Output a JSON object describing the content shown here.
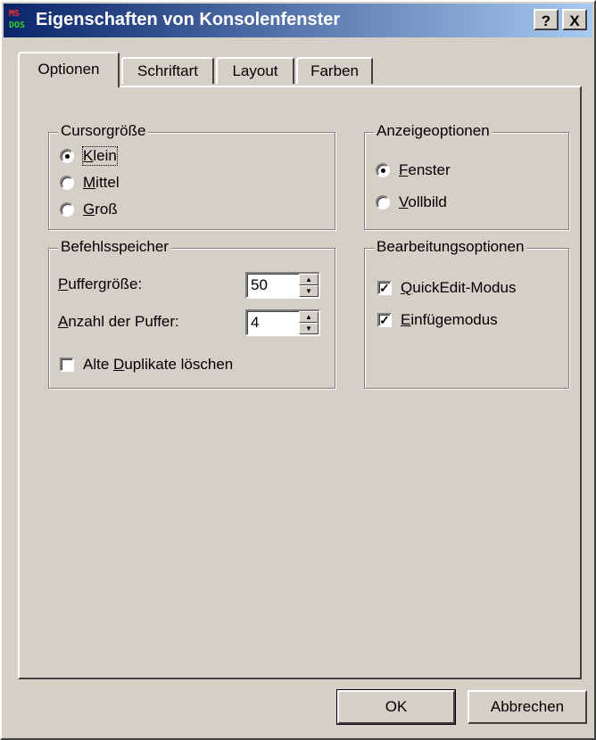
{
  "window": {
    "title": "Eigenschaften von Konsolenfenster",
    "icon_label": [
      "MS",
      "DOS"
    ],
    "help_button": "?",
    "close_button": "X"
  },
  "tabs": [
    {
      "label": "Optionen",
      "active": true
    },
    {
      "label": "Schriftart",
      "active": false
    },
    {
      "label": "Layout",
      "active": false
    },
    {
      "label": "Farben",
      "active": false
    }
  ],
  "cursor_size": {
    "legend": "Cursorgröße",
    "options": [
      {
        "pre": "",
        "mnemonic": "K",
        "post": "lein",
        "selected": true
      },
      {
        "pre": "",
        "mnemonic": "M",
        "post": "ittel",
        "selected": false
      },
      {
        "pre": "",
        "mnemonic": "G",
        "post": "roß",
        "selected": false
      }
    ]
  },
  "display_options": {
    "legend": "Anzeigeoptionen",
    "options": [
      {
        "pre": "",
        "mnemonic": "F",
        "post": "enster",
        "selected": true
      },
      {
        "pre": "",
        "mnemonic": "V",
        "post": "ollbild",
        "selected": false
      }
    ]
  },
  "command_history": {
    "legend": "Befehlsspeicher",
    "buffer_size": {
      "pre": "",
      "mnemonic": "P",
      "post": "uffergröße:",
      "value": "50"
    },
    "buffer_count": {
      "pre": "",
      "mnemonic": "A",
      "post": "nzahl der Puffer:",
      "value": "4"
    },
    "discard_duplicates": {
      "pre": "Alte ",
      "mnemonic": "D",
      "post": "uplikate löschen",
      "checked": false
    }
  },
  "edit_options": {
    "legend": "Bearbeitungsoptionen",
    "quickedit": {
      "pre": "",
      "mnemonic": "Q",
      "post": "uickEdit-Modus",
      "checked": true
    },
    "insert": {
      "pre": "",
      "mnemonic": "E",
      "post": "infügemodus",
      "checked": true
    }
  },
  "buttons": {
    "ok": "OK",
    "cancel": "Abbrechen"
  }
}
